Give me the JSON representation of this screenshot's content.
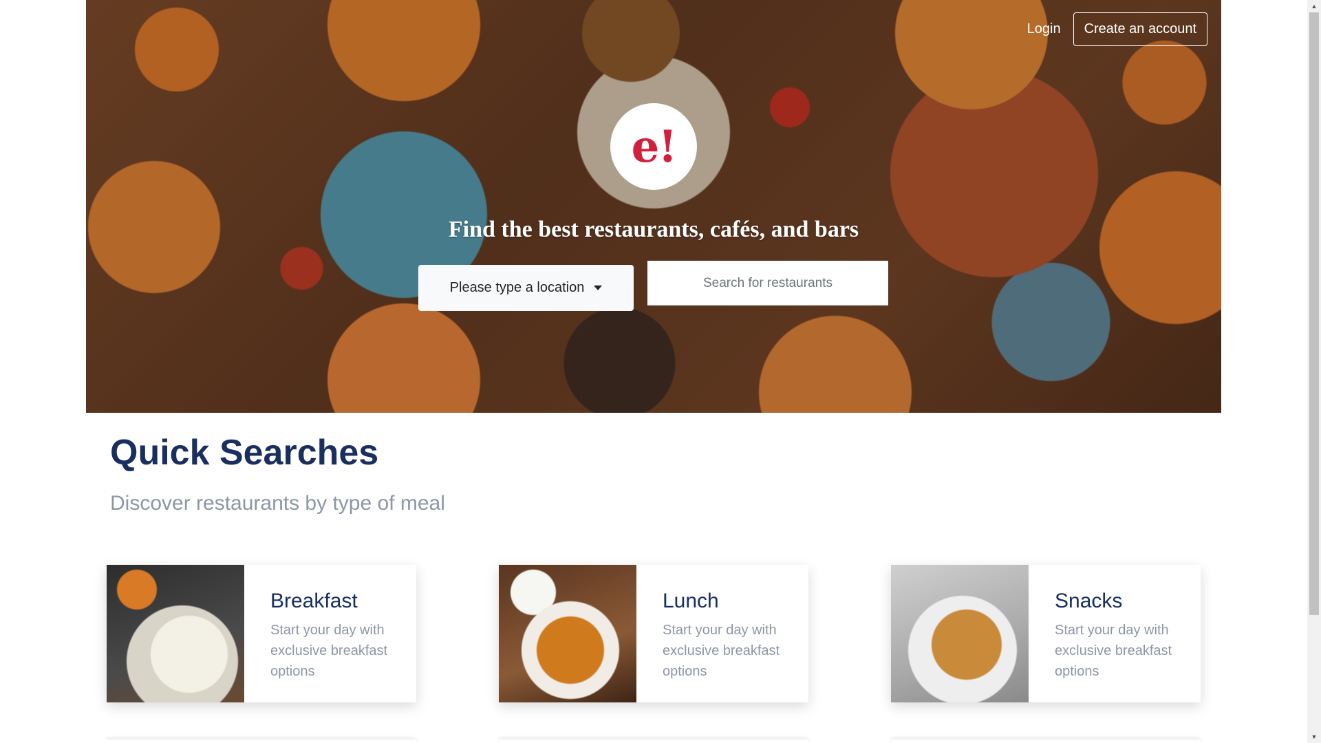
{
  "nav": {
    "login_label": "Login",
    "signup_label": "Create an account"
  },
  "hero": {
    "logo_text": "e!",
    "headline": "Find the best restaurants, cafés, and bars",
    "location_label": "Please type a location",
    "search_placeholder": "Search for restaurants"
  },
  "quick_searches": {
    "title": "Quick Searches",
    "subtitle": "Discover restaurants by type of meal",
    "cards": [
      {
        "title": "Breakfast",
        "description": "Start your day with exclusive breakfast options",
        "image_name": "breakfast-image"
      },
      {
        "title": "Lunch",
        "description": "Start your day with exclusive breakfast options",
        "image_name": "lunch-image"
      },
      {
        "title": "Snacks",
        "description": "Start your day with exclusive breakfast options",
        "image_name": "snacks-image"
      }
    ]
  },
  "colors": {
    "brand_red": "#d21f3c",
    "heading_navy": "#192f60",
    "muted_text": "#8c96a7"
  }
}
